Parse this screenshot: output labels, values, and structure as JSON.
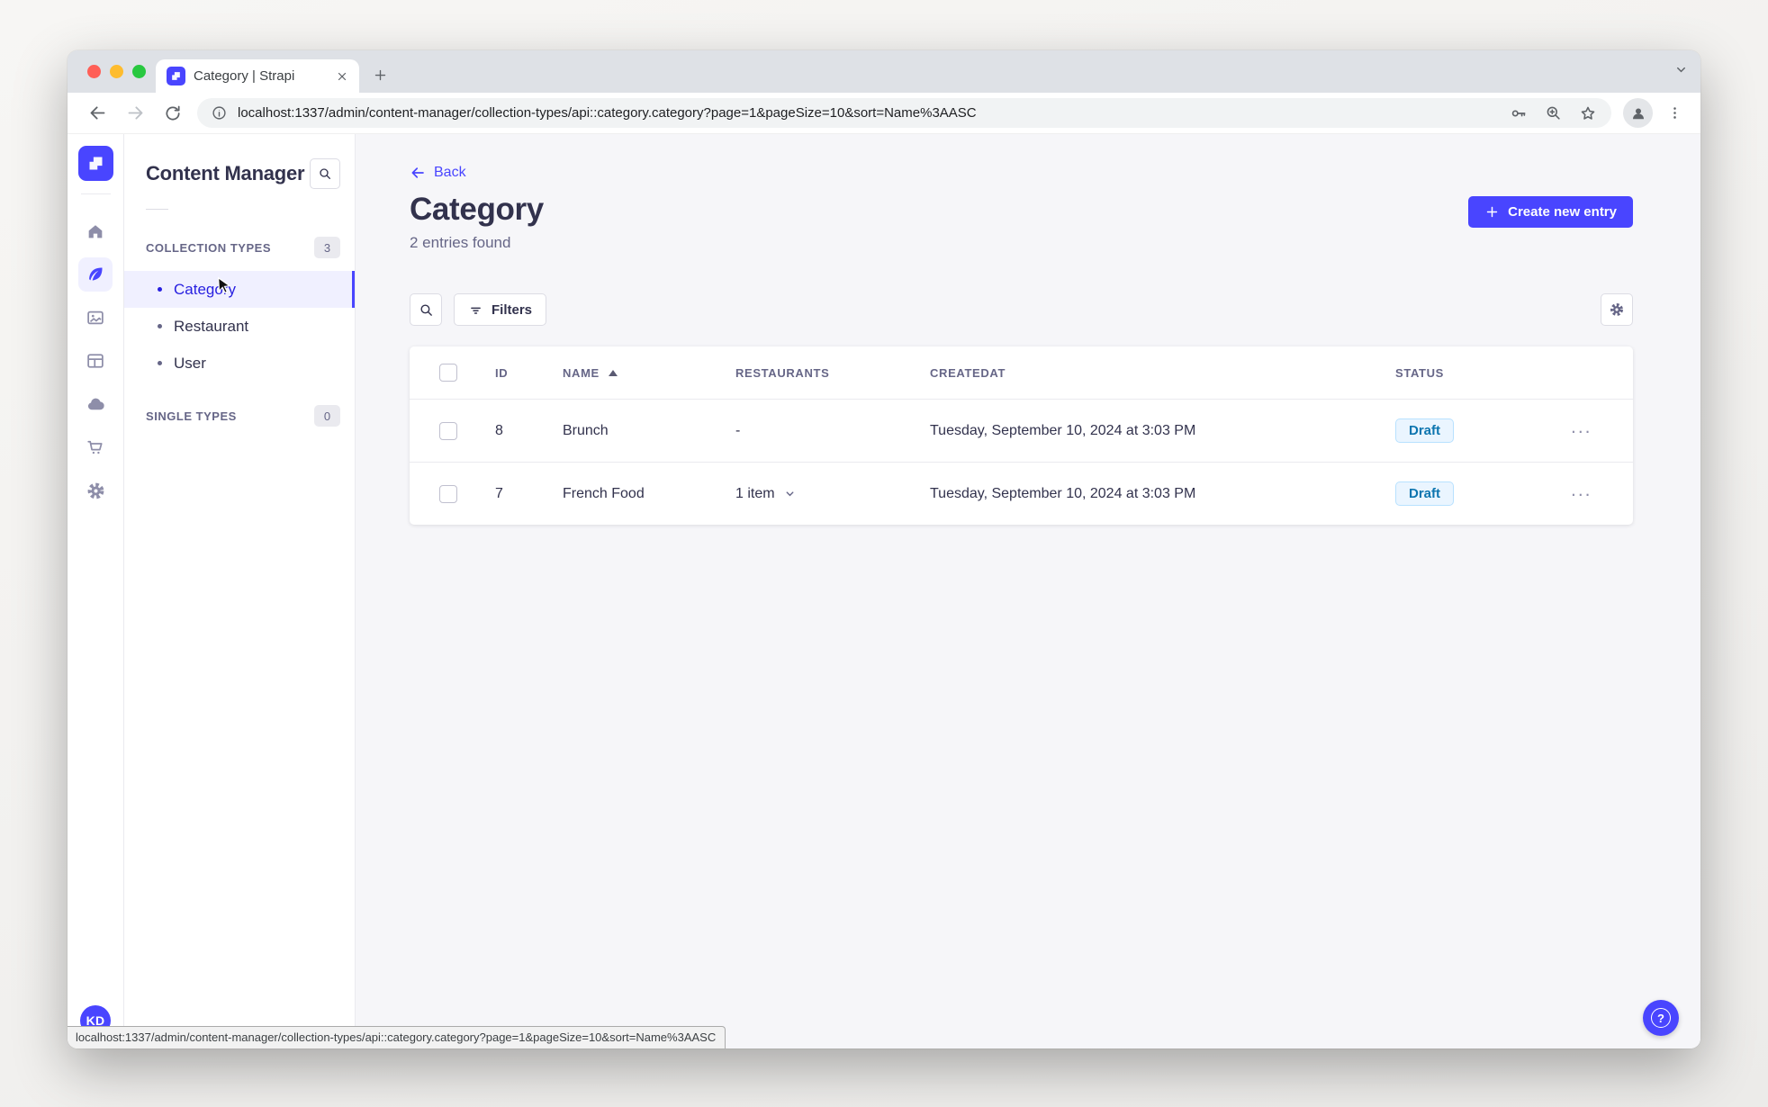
{
  "colors": {
    "primary": "#4945FF",
    "primary_light_bg": "#F0F0FF",
    "active_text": "#271FE0",
    "draft_bg": "#EAF5FF",
    "draft_border": "#B8E1FF",
    "draft_text": "#0C75AF",
    "traffic_lights": [
      "#FF5F57",
      "#FEBC2E",
      "#28C840"
    ]
  },
  "browser": {
    "tab_title": "Category | Strapi",
    "url": "localhost:1337/admin/content-manager/collection-types/api::category.category?page=1&pageSize=10&sort=Name%3AASC",
    "status_url": "localhost:1337/admin/content-manager/collection-types/api::category.category?page=1&pageSize=10&sort=Name%3AASC"
  },
  "icons": {
    "tab_favicon": "strapi-logo",
    "tab_close": "x",
    "new_tab": "plus",
    "tab_strip_menu": "chevron-down",
    "browser_back": "arrow-left",
    "browser_forward": "arrow-right",
    "reload": "refresh-circle-arrow",
    "site_info": "info-circle",
    "password_manager": "key",
    "page_zoom": "magnifier-plus",
    "bookmark": "star-outline",
    "profile": "person-circle",
    "browser_menu": "dots-vertical",
    "rail": [
      "strapi-logo",
      "home",
      "feather-pen",
      "media-library-picture",
      "content-builder-layout",
      "cloud",
      "marketplace-cart",
      "settings-gear"
    ],
    "subnav_search": "magnifier",
    "back": "arrow-left",
    "create_entry": "plus",
    "list_search": "magnifier",
    "filters": "filter-lines",
    "view_settings": "gear",
    "sort_ascending": "triangle-up",
    "relation_dropdown": "chevron-down",
    "row_actions": "ellipsis",
    "help": "question-circle"
  },
  "nav": {
    "subnav_title": "Content Manager",
    "collection_types_label": "COLLECTION TYPES",
    "collection_types_count": "3",
    "items": [
      {
        "label": "Category"
      },
      {
        "label": "Restaurant"
      },
      {
        "label": "User"
      }
    ],
    "single_types_label": "SINGLE TYPES",
    "single_types_count": "0"
  },
  "header": {
    "back_label": "Back",
    "title": "Category",
    "subtitle": "2 entries found",
    "create_button_label": "Create new entry"
  },
  "list_toolbar": {
    "filters_label": "Filters"
  },
  "table": {
    "headers": [
      "ID",
      "NAME",
      "RESTAURANTS",
      "CREATEDAT",
      "STATUS"
    ],
    "rows": [
      {
        "id": "8",
        "name": "Brunch",
        "restaurants": "-",
        "createdat": "Tuesday, September 10, 2024 at 3:03 PM",
        "status": "Draft"
      },
      {
        "id": "7",
        "name": "French Food",
        "restaurants": "1 item",
        "createdat": "Tuesday, September 10, 2024 at 3:03 PM",
        "status": "Draft"
      }
    ]
  },
  "user": {
    "initials": "KD"
  }
}
